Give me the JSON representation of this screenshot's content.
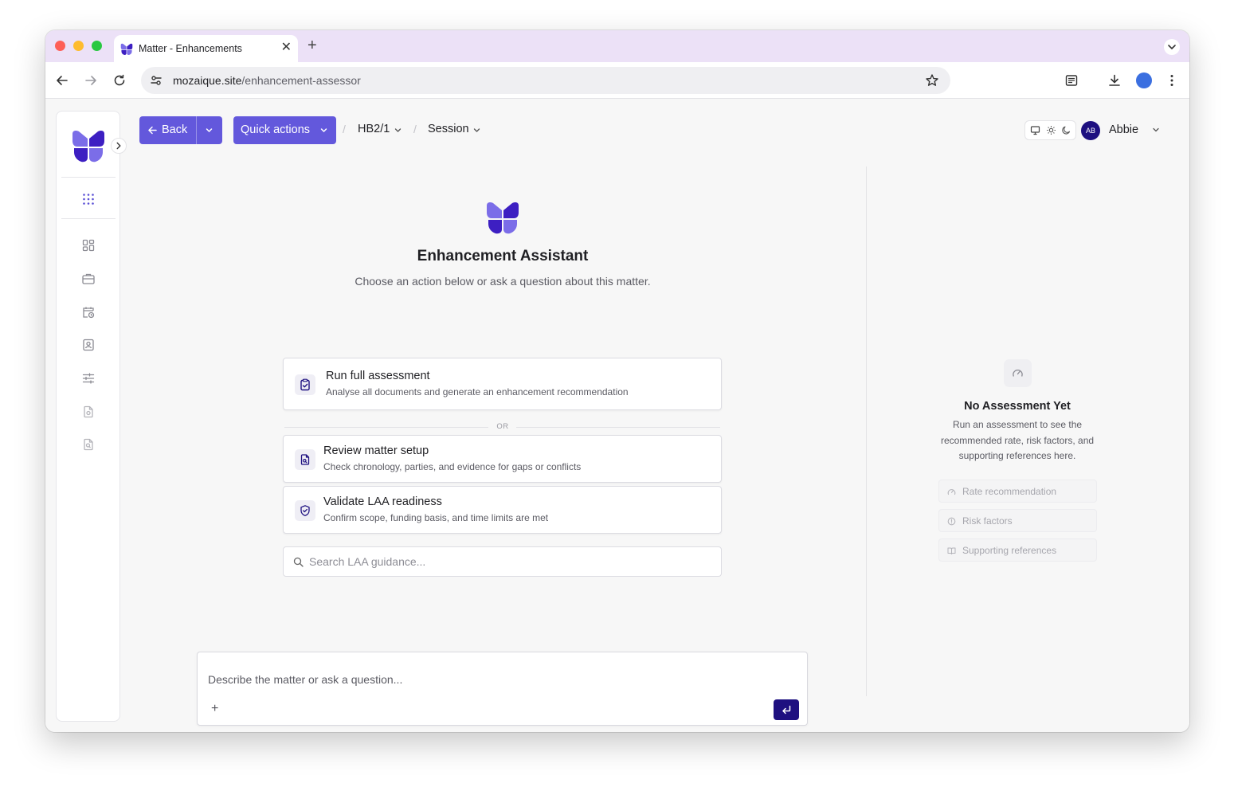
{
  "browser": {
    "tab_title": "Matter - Enhancements",
    "url_domain": "mozaique.site",
    "url_path": "/enhancement-assessor"
  },
  "header": {
    "back_label": "Back",
    "quick_actions_label": "Quick actions",
    "breadcrumb_1": "HB2/1",
    "breadcrumb_2": "Session",
    "user_initials": "AB",
    "user_name": "Abbie"
  },
  "assistant": {
    "title": "Enhancement Assistant",
    "subtitle": "Choose an action below or ask a question about this matter.",
    "or_label": "OR",
    "actions": [
      {
        "title": "Run full assessment",
        "description": "Analyse all documents and generate an enhancement recommendation",
        "icon": "clipboard-check-icon"
      },
      {
        "title": "Review matter setup",
        "description": "Check chronology, parties, and evidence for gaps or conflicts",
        "icon": "file-search-icon"
      },
      {
        "title": "Validate LAA readiness",
        "description": "Confirm scope, funding basis, and time limits are met",
        "icon": "shield-check-icon"
      }
    ],
    "search_placeholder": "Search LAA guidance...",
    "composer_placeholder": "Describe the matter or ask a question..."
  },
  "results_panel": {
    "title": "No Assessment Yet",
    "text": "Run an assessment to see the recommended rate, risk factors, and supporting references here.",
    "items": [
      {
        "label": "Rate recommendation",
        "icon": "gauge-icon"
      },
      {
        "label": "Risk factors",
        "icon": "alert-circle-icon"
      },
      {
        "label": "Supporting references",
        "icon": "book-icon"
      }
    ]
  },
  "colors": {
    "primary": "#6358dc",
    "dark_accent": "#1e1080",
    "tab_strip": "#ece1f7",
    "logo_dark": "#3d1fc2",
    "logo_light": "#7b6de8"
  }
}
